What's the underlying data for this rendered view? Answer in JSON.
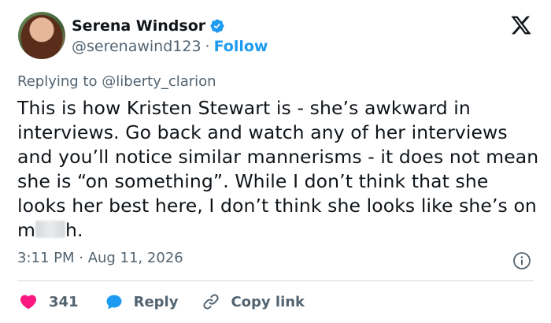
{
  "author": {
    "display_name": "Serena Windsor",
    "handle": "@serenawind123",
    "separator": "·",
    "follow_label": "Follow",
    "verified": true,
    "verified_color": "#1d9bf0"
  },
  "platform_icon": "x-logo-icon",
  "reply": {
    "prefix": "Replying to ",
    "mention": "@liberty_clarion"
  },
  "tweet": {
    "text_main": "This is how Kristen Stewart is - she’s awkward in interviews. Go back and watch any of her interviews and you’ll notice similar mannerisms - it does not mean she is “on something”. While I don’t think that she looks her best here, I don’t think she looks like she’s on m",
    "text_end": "h."
  },
  "timestamp": "3:11 PM · Aug 11, 2026",
  "actions": {
    "like_count": "341",
    "reply_label": "Reply",
    "copy_label": "Copy link",
    "like_color": "#f91880",
    "reply_color": "#1d9bf0",
    "copy_icon": "link-icon"
  },
  "colors": {
    "text": "#0f1419",
    "secondary": "#536471",
    "accent": "#1d9bf0",
    "divider": "#cfd9de"
  }
}
